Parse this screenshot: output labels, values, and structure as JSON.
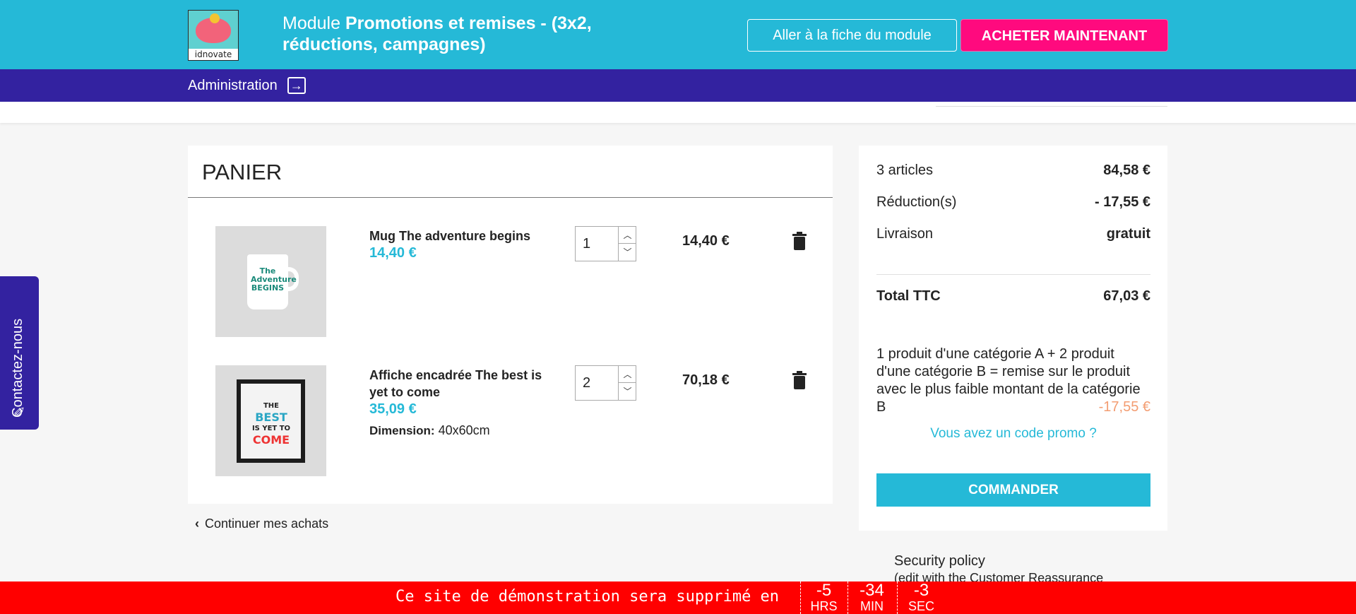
{
  "topbar": {
    "logo_text": "idnovate",
    "title_prefix": "Module ",
    "title_bold": "Promotions et remises - (3x2, réductions, campagnes)",
    "fiche_button": "Aller à la fiche du module",
    "buy_button": "ACHETER MAINTENANT",
    "accent": "#25b9d7",
    "buy_color": "#ff0a7e"
  },
  "adminbar": {
    "label": "Administration",
    "icon": "sign-in-icon",
    "color": "#3322a0"
  },
  "cart": {
    "title": "PANIER",
    "items": [
      {
        "name": "Mug The adventure begins",
        "unit_price": "14,40 €",
        "quantity": "1",
        "line_total": "14,40 €",
        "image_text": "The Adventure BEGINS"
      },
      {
        "name": "Affiche encadrée The best is yet to come",
        "unit_price": "35,09 €",
        "attr_key": "Dimension:",
        "attr_value": "40x60cm",
        "quantity": "2",
        "line_total": "70,18 €",
        "image_text": "THE BEST IS YET TO COME"
      }
    ],
    "continue_label": "Continuer mes achats"
  },
  "summary": {
    "articles_label": "3 articles",
    "articles_value": "84,58 €",
    "reduction_label": "Réduction(s)",
    "reduction_value": "- 17,55 €",
    "shipping_label": "Livraison",
    "shipping_value": "gratuit",
    "total_label": "Total TTC",
    "total_value": "67,03 €",
    "promo_text": "1 produit d'une catégorie A + 2 produit d'une catégorie B = remise sur le produit avec le plus faible montant de la catégorie B",
    "promo_amount": "-17,55 €",
    "code_link": "Vous avez un code promo ?",
    "checkout_button": "COMMANDER"
  },
  "reassurance": {
    "title": "Security policy",
    "subtitle": "(edit with the Customer Reassurance"
  },
  "contact_tab": {
    "label": "Contactez-nous"
  },
  "countdown": {
    "text": "Ce site de démonstration sera supprimé en",
    "hours": "-5",
    "hours_unit": "HRS",
    "minutes": "-34",
    "minutes_unit": "MIN",
    "seconds": "-3",
    "seconds_unit": "SEC",
    "color": "#ff0000"
  }
}
